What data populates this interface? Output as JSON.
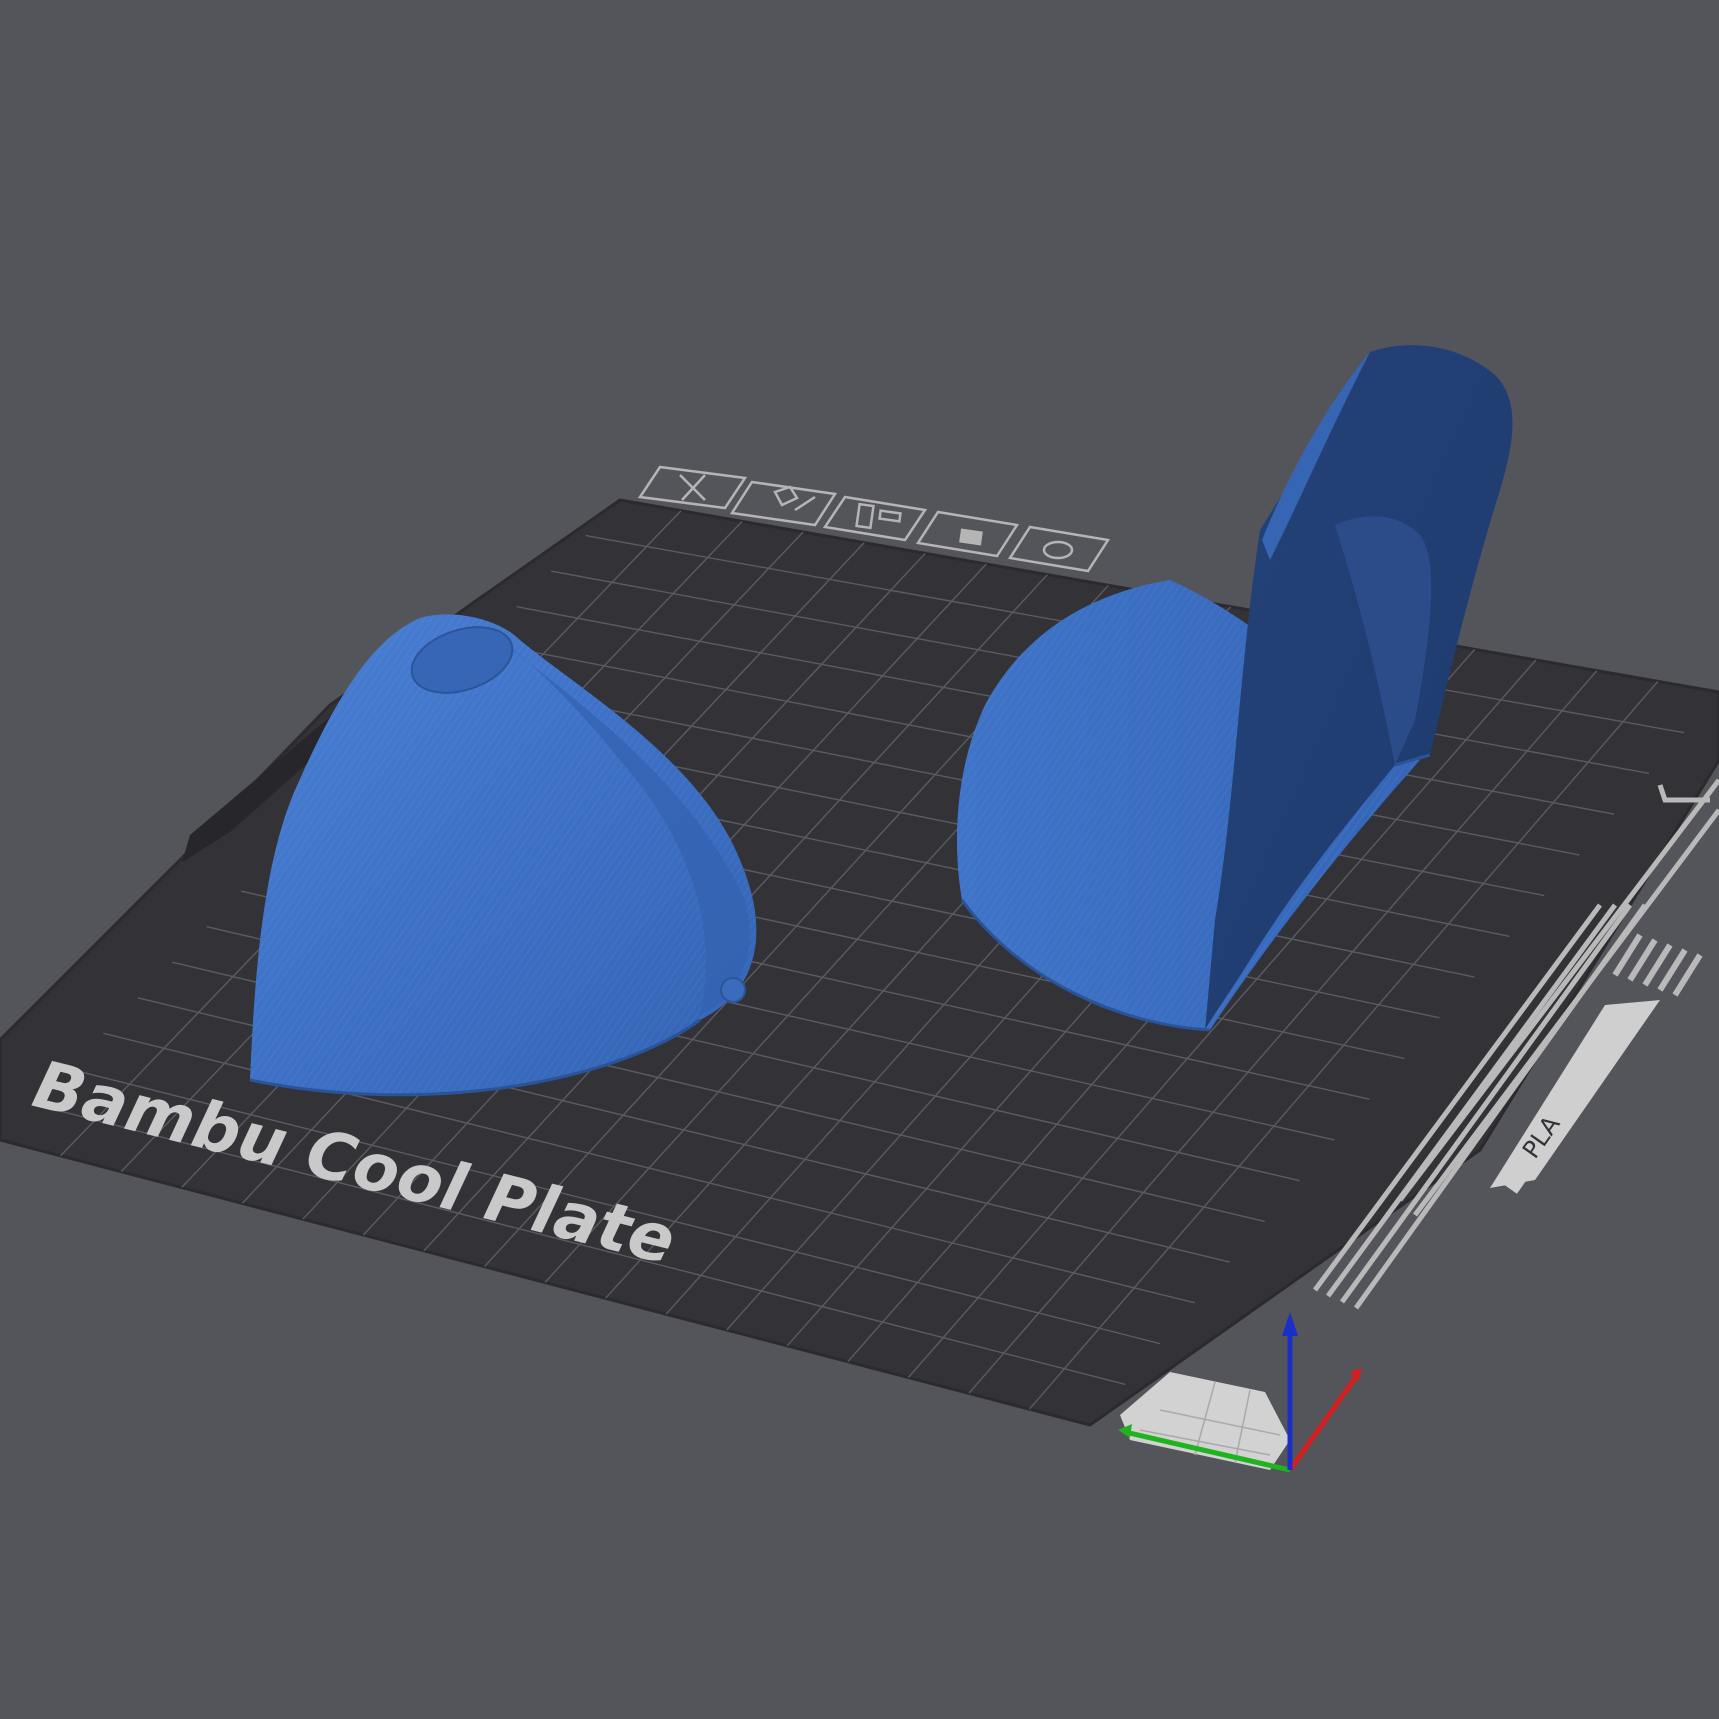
{
  "scene": {
    "plate_label": "Bambu Cool Plate",
    "filament_label": "PLA",
    "colors": {
      "background": "#54545b",
      "plate": "#323237",
      "plate_edge": "#2a2a2f",
      "grid": "#5b5b63",
      "label": "#c9c9c9",
      "model": "#3b6fc2",
      "model_shadow": "#2a4f90",
      "axis_x": "#d42020",
      "axis_y": "#1fb41f",
      "axis_z": "#1a2fc8"
    }
  },
  "plate_toolbar": {
    "icons": [
      "close-icon",
      "arrange-icon",
      "orient-icon",
      "lock-icon",
      "settings-icon"
    ]
  },
  "objects": [
    "dome-shell-left",
    "dome-shell-with-fin-right"
  ]
}
